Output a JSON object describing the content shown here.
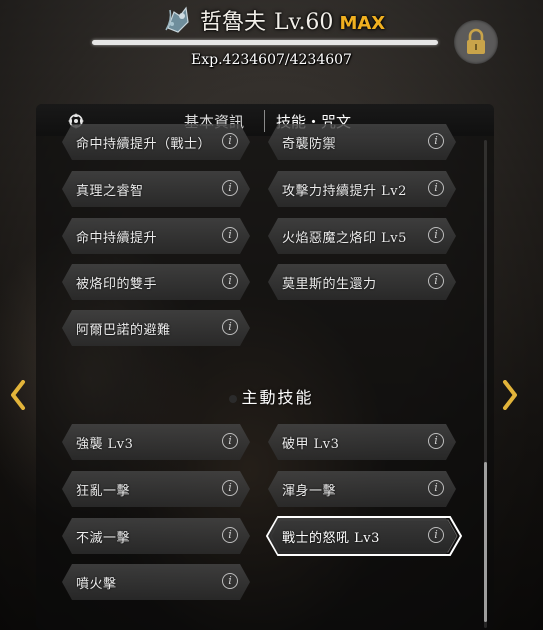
{
  "header": {
    "pet_name": "哲魯夫",
    "level": "Lv.60",
    "max_label": "MAX",
    "exp_text": "Exp.4234607/4234607",
    "exp_fraction": 1.0
  },
  "tabs": {
    "basic_info": "基本資訊",
    "skills_runes": "技能・咒文"
  },
  "passive_skills": [
    {
      "label": "命中持續提升（戰士）"
    },
    {
      "label": "奇襲防禦"
    },
    {
      "label": "真理之睿智"
    },
    {
      "label": "攻擊力持續提升 Lv2"
    },
    {
      "label": "命中持續提升"
    },
    {
      "label": "火焰惡魔之烙印 Lv5"
    },
    {
      "label": "被烙印的雙手"
    },
    {
      "label": "莫里斯的生還力"
    },
    {
      "label": "阿爾巴諾的避難"
    }
  ],
  "active_section_title": "主動技能",
  "active_skills": [
    {
      "label": "強襲 Lv3"
    },
    {
      "label": "破甲 Lv3"
    },
    {
      "label": "狂亂一擊"
    },
    {
      "label": "渾身一擊"
    },
    {
      "label": "不滅一擊"
    },
    {
      "label": "戰士的怒吼 Lv3",
      "selected": true
    },
    {
      "label": "噴火擊"
    }
  ],
  "colors": {
    "max_accent": "#f0b020",
    "panel_bg": "#0c0c0c",
    "skill_button": "#464646",
    "selected_border": "#ffffff",
    "arrow": "#e2b43a"
  },
  "icons": {
    "pet": "pet-portrait-icon",
    "lock": "lock-icon",
    "tab": "emblem-icon",
    "info": "info-icon",
    "prev": "chevron-left-icon",
    "next": "chevron-right-icon"
  }
}
